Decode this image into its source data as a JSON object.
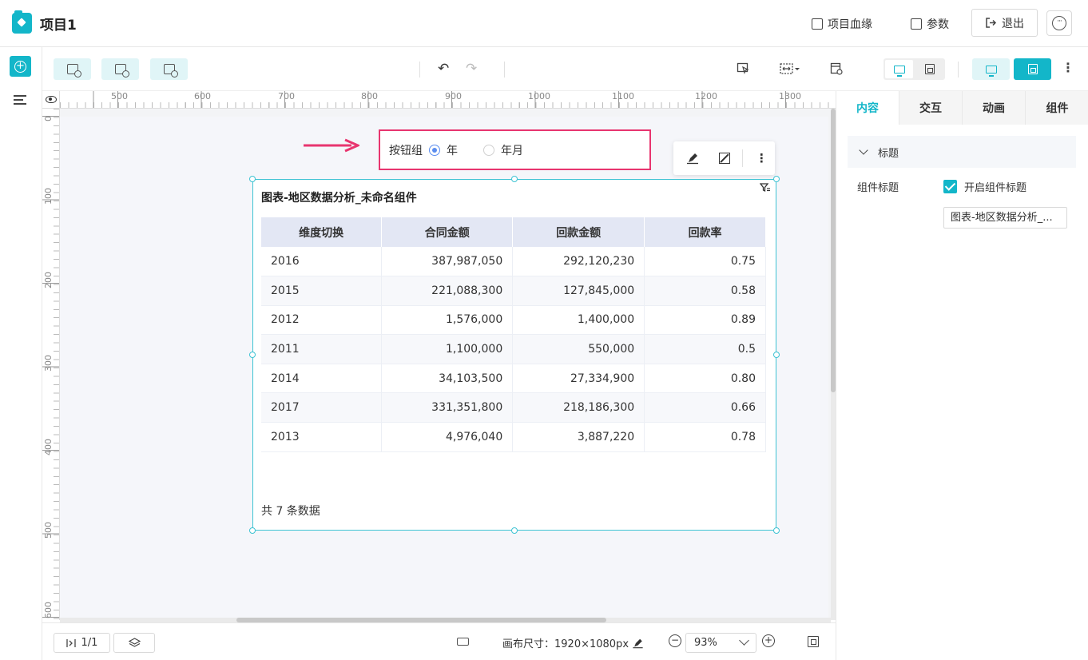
{
  "header": {
    "title": "项目1",
    "lineage_label": "项目血缘",
    "params_label": "参数",
    "exit_label": "退出"
  },
  "toolbar": {
    "items": [
      "add-component-icon",
      "add-filter-icon",
      "add-table-icon"
    ],
    "undo": "↶",
    "redo": "↷"
  },
  "ruler": {
    "h_ticks": [
      "500",
      "600",
      "700",
      "800",
      "900",
      "1000",
      "1100",
      "1200",
      "1300"
    ],
    "v_ticks": [
      "0",
      "100",
      "200",
      "300",
      "400",
      "500",
      "600"
    ]
  },
  "button_group": {
    "label": "按钮组",
    "options": [
      {
        "label": "年",
        "checked": true
      },
      {
        "label": "年月",
        "checked": false
      }
    ]
  },
  "widget": {
    "title": "图表-地区数据分析_未命名组件",
    "columns": [
      "维度切换",
      "合同金额",
      "回款金额",
      "回款率"
    ],
    "rows": [
      [
        "2016",
        "387,987,050",
        "292,120,230",
        "0.75"
      ],
      [
        "2015",
        "221,088,300",
        "127,845,000",
        "0.58"
      ],
      [
        "2012",
        "1,576,000",
        "1,400,000",
        "0.89"
      ],
      [
        "2011",
        "1,100,000",
        "550,000",
        "0.5"
      ],
      [
        "2014",
        "34,103,500",
        "27,334,900",
        "0.80"
      ],
      [
        "2017",
        "331,351,800",
        "218,186,300",
        "0.66"
      ],
      [
        "2013",
        "4,976,040",
        "3,887,220",
        "0.78"
      ]
    ],
    "footer": "共 7 条数据"
  },
  "bottom": {
    "page": "1/1",
    "canvas_size": "画布尺寸：1920×1080px",
    "zoom": "93%"
  },
  "right_panel": {
    "tabs": [
      "内容",
      "交互",
      "动画",
      "组件"
    ],
    "section": "标题",
    "prop_label": "组件标题",
    "check_label": "开启组件标题",
    "title_value": "图表-地区数据分析_..."
  },
  "colors": {
    "accent": "#13b6c9",
    "highlight": "#e8356f",
    "table_header": "#e3e7f4"
  }
}
